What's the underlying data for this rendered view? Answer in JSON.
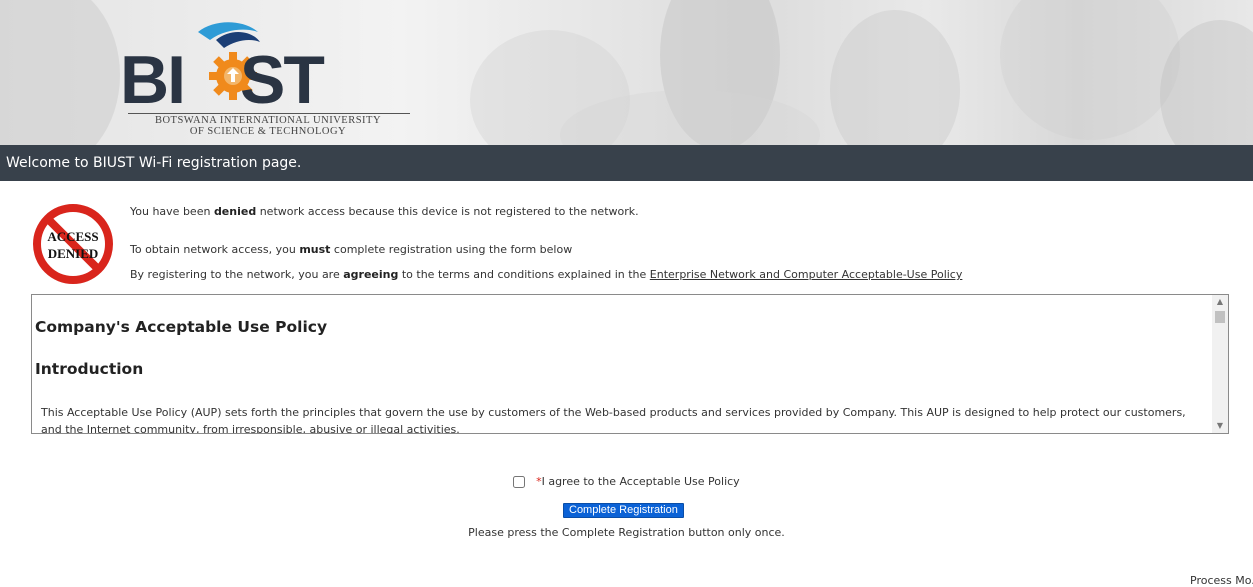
{
  "header": {
    "logo_wordmark": "BIUST",
    "logo_line1": "BOTSWANA INTERNATIONAL UNIVERSITY",
    "logo_line2": "OF SCIENCE & TECHNOLOGY"
  },
  "welcome_text": "Welcome to BIUST Wi-Fi registration page.",
  "denied_icon": {
    "name": "access-denied-icon",
    "line1": "ACCESS",
    "line2": "DENIED",
    "color": "#d9251c"
  },
  "notice": {
    "line1_pre": "You have been ",
    "line1_bold": "denied",
    "line1_post": " network access because this device is not registered to the network.",
    "line2_pre": "To obtain network access, you ",
    "line2_bold": "must",
    "line2_post": " complete registration using the form below",
    "line3_pre": "By registering to the network, you are ",
    "line3_bold": "agreeing",
    "line3_mid": " to the terms and conditions explained in the ",
    "line3_link": "Enterprise Network and Computer Acceptable-Use Policy"
  },
  "aup": {
    "title": "Company's Acceptable Use Policy",
    "section_heading": "Introduction",
    "intro_text": "This Acceptable Use Policy (AUP) sets forth the principles that govern the use by customers of the Web-based products and services provided by Company. This AUP is designed to help protect our customers, and the Internet community, from irresponsible, abusive or illegal activities."
  },
  "agreement": {
    "required_marker": "*",
    "label": "I agree to the Acceptable Use Policy",
    "checked": false
  },
  "submit_label": "Complete Registration",
  "submit_note": "Please press the Complete Registration button only once.",
  "footer_link": "Process Mo...",
  "colors": {
    "welcome_bar": "#38414b",
    "button": "#0b62d6",
    "required": "#d9251c"
  }
}
